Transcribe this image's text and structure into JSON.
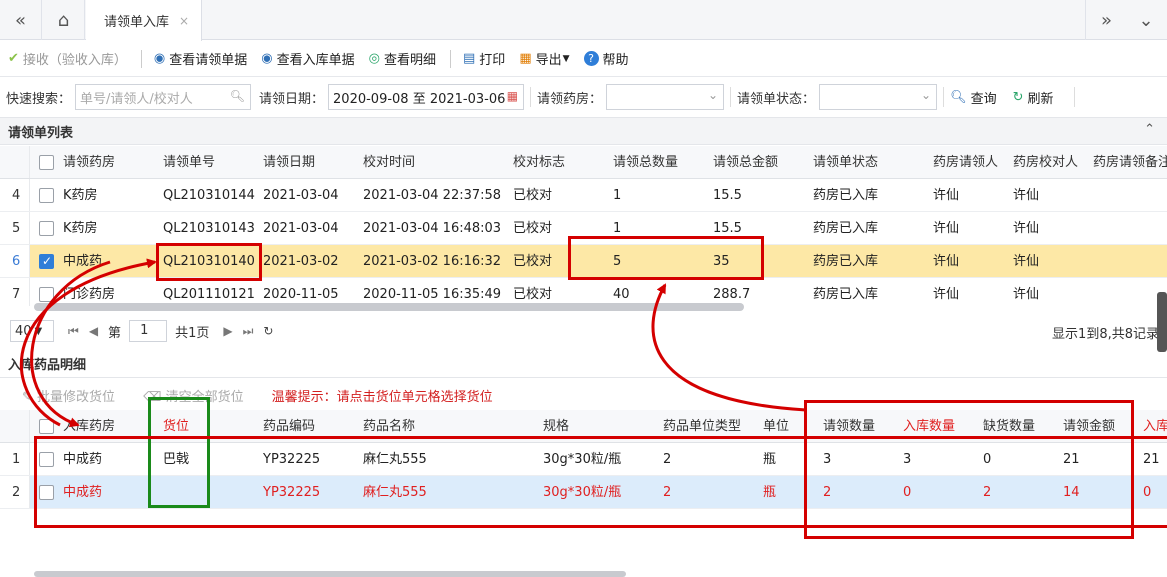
{
  "tabbar": {
    "active_tab": "请领单入库",
    "close": "×"
  },
  "toolbar": {
    "receive": "接收（验收入库）",
    "view_request": "查看请领单据",
    "view_inbound": "查看入库单据",
    "view_detail": "查看明细",
    "print": "打印",
    "export": "导出",
    "help": "帮助"
  },
  "search": {
    "quick_label": "快速搜索：",
    "quick_placeholder": "单号/请领人/校对人",
    "date_label": "请领日期：",
    "date_value": "2020-09-08 至 2021-03-06",
    "pharmacy_label": "请领药房：",
    "status_label": "请领单状态：",
    "query": "查询",
    "refresh": "刷新"
  },
  "list_panel": {
    "title": "请领单列表",
    "columns": [
      "请领药房",
      "请领单号",
      "请领日期",
      "校对时间",
      "校对标志",
      "请领总数量",
      "请领总金额",
      "请领单状态",
      "药房请领人",
      "药房校对人",
      "药房请领备注"
    ],
    "rows": [
      {
        "num": "4",
        "pharmacy": "K药房",
        "no": "QL210310144",
        "date": "2021-03-04",
        "check_time": "2021-03-04 22:37:58",
        "flag": "已校对",
        "qty": "1",
        "amount": "15.5",
        "status": "药房已入库",
        "requester": "许仙",
        "checker": "许仙"
      },
      {
        "num": "5",
        "pharmacy": "K药房",
        "no": "QL210310143",
        "date": "2021-03-04",
        "check_time": "2021-03-04 16:48:03",
        "flag": "已校对",
        "qty": "1",
        "amount": "15.5",
        "status": "药房已入库",
        "requester": "许仙",
        "checker": "许仙"
      },
      {
        "num": "6",
        "pharmacy": "中成药",
        "no": "QL210310140",
        "date": "2021-03-02",
        "check_time": "2021-03-02 16:16:32",
        "flag": "已校对",
        "qty": "5",
        "amount": "35",
        "status": "药房已入库",
        "requester": "许仙",
        "checker": "许仙"
      },
      {
        "num": "7",
        "pharmacy": "门诊药房",
        "no": "QL201110121",
        "date": "2020-11-05",
        "check_time": "2020-11-05 16:35:49",
        "flag": "已校对",
        "qty": "40",
        "amount": "288.7",
        "status": "药房已入库",
        "requester": "许仙",
        "checker": "许仙"
      }
    ]
  },
  "pager": {
    "page_size": "40",
    "page_label": "第",
    "page": "1",
    "total_label": "共1页",
    "info": "显示1到8,共8记录"
  },
  "detail_panel": {
    "title": "入库药品明细",
    "batch_edit": "批量修改货位",
    "clear_all": "清空全部货位",
    "hint": "温馨提示：请点击货位单元格选择货位",
    "columns": [
      "入库药房",
      "货位",
      "药品编码",
      "药品名称",
      "规格",
      "药品单位类型",
      "单位",
      "请领数量",
      "入库数量",
      "缺货数量",
      "请领金额",
      "入库"
    ],
    "rows": [
      {
        "num": "1",
        "pharmacy": "中成药",
        "location": "巴戟",
        "code": "YP32225",
        "name": "麻仁丸555",
        "spec": "30g*30粒/瓶",
        "unit_type": "2",
        "unit": "瓶",
        "req_qty": "3",
        "in_qty": "3",
        "short_qty": "0",
        "req_amount": "21",
        "in_amount": "21"
      },
      {
        "num": "2",
        "pharmacy": "中成药",
        "location": "",
        "code": "YP32225",
        "name": "麻仁丸555",
        "spec": "30g*30粒/瓶",
        "unit_type": "2",
        "unit": "瓶",
        "req_qty": "2",
        "in_qty": "0",
        "short_qty": "2",
        "req_amount": "14",
        "in_amount": "0"
      }
    ]
  },
  "colors": {
    "selected_row": "#fde8a6",
    "annotation_red": "#d40000",
    "annotation_green": "#1a8a1a",
    "warning_text": "#e02020"
  }
}
